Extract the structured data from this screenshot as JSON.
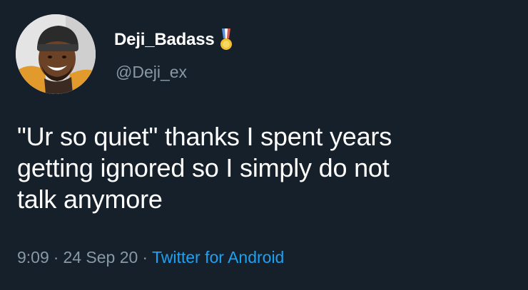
{
  "tweet": {
    "author": {
      "display_name": "Deji_Badass",
      "handle": "@Deji_ex",
      "badge_icon": "medal-icon",
      "avatar_icon": "avatar-photo"
    },
    "text_lines": [
      "\"Ur so quiet\" thanks I spent years",
      "getting ignored so I simply do not",
      "talk anymore"
    ],
    "time": "9:09",
    "separator": "·",
    "date": "24 Sep 20",
    "source": "Twitter for Android"
  },
  "colors": {
    "background": "#15202b",
    "primary_text": "#ffffff",
    "secondary_text": "#8899a6",
    "link": "#1da1f2"
  }
}
